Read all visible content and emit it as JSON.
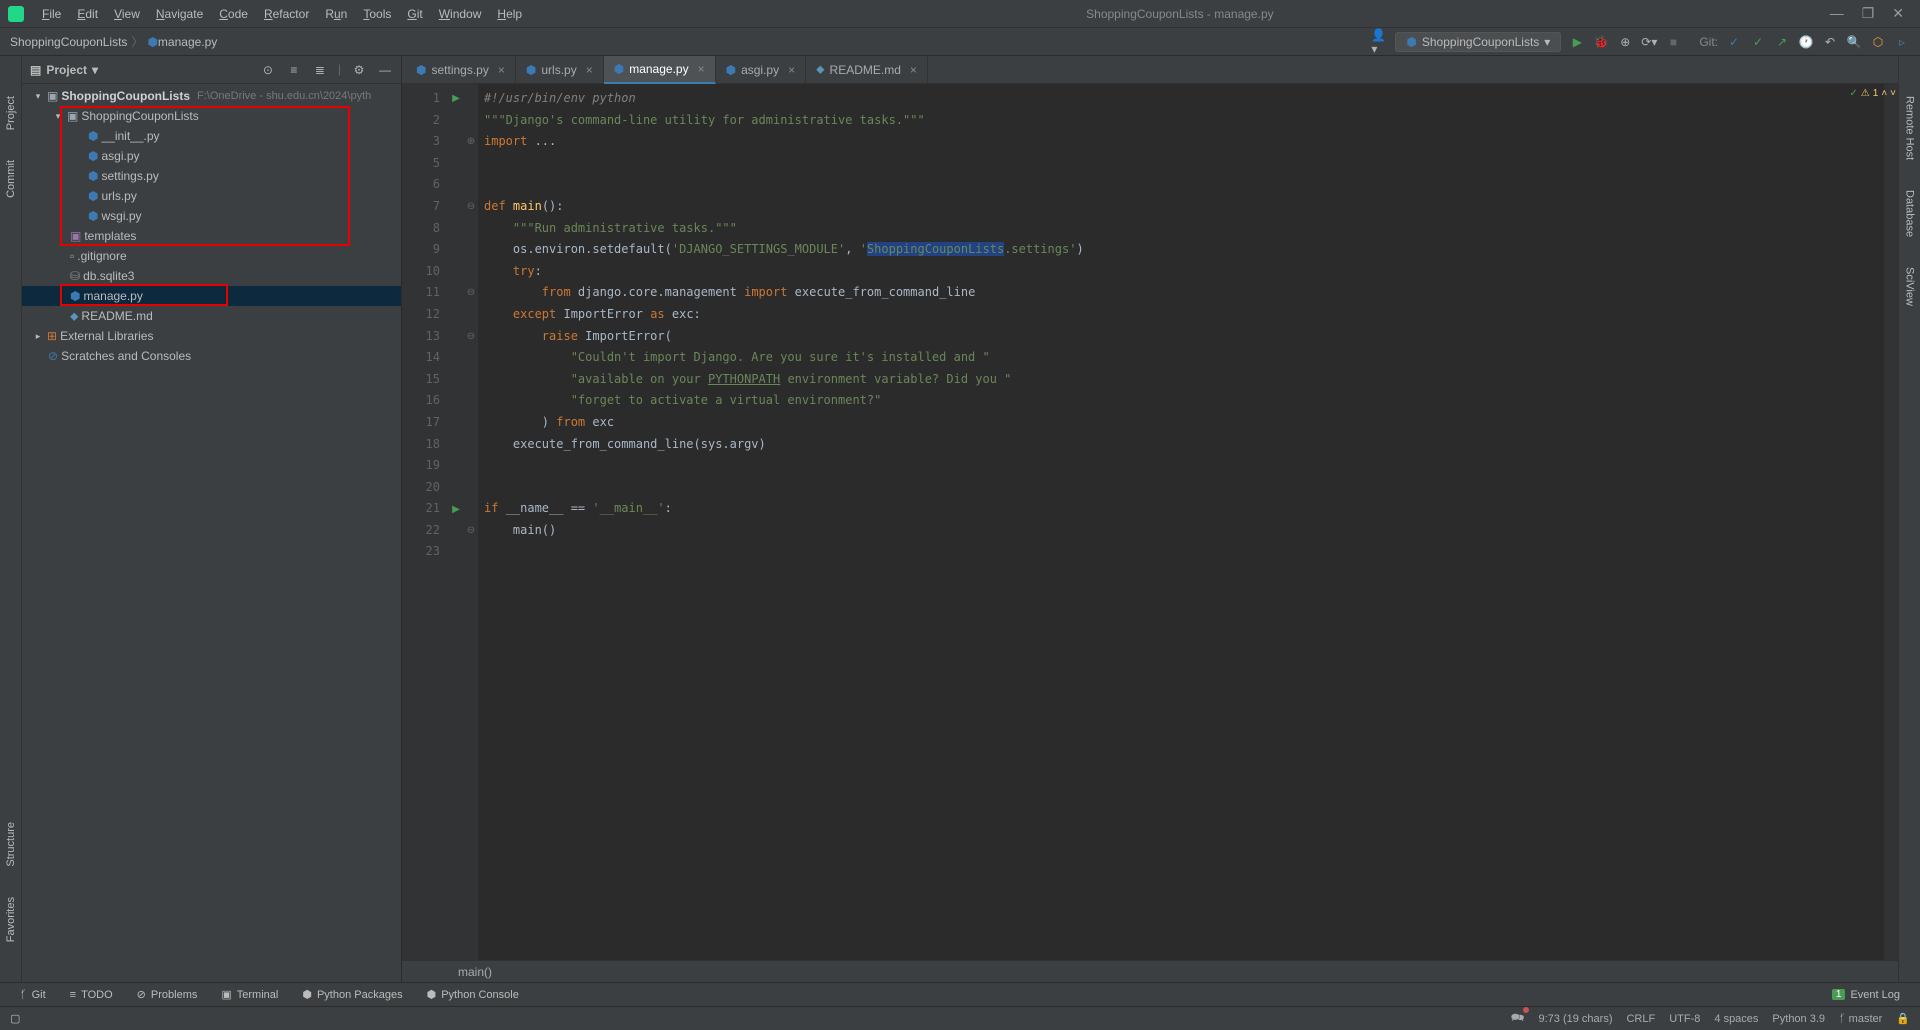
{
  "window": {
    "title": "ShoppingCouponLists - manage.py",
    "menus": [
      "File",
      "Edit",
      "View",
      "Navigate",
      "Code",
      "Refactor",
      "Run",
      "Tools",
      "Git",
      "Window",
      "Help"
    ]
  },
  "breadcrumb": {
    "root": "ShoppingCouponLists",
    "file": "manage.py"
  },
  "run_config": "ShoppingCouponLists",
  "git_label": "Git:",
  "project_panel": {
    "title": "Project",
    "tree": {
      "root": "ShoppingCouponLists",
      "root_path": "F:\\OneDrive - shu.edu.cn\\2024\\pyth",
      "pkg": "ShoppingCouponLists",
      "files": [
        "__init__.py",
        "asgi.py",
        "settings.py",
        "urls.py",
        "wsgi.py"
      ],
      "templates": "templates",
      "gitignore": ".gitignore",
      "db": "db.sqlite3",
      "manage": "manage.py",
      "readme": "README.md",
      "ext": "External Libraries",
      "scratch": "Scratches and Consoles"
    }
  },
  "tabs": [
    {
      "label": "settings.py"
    },
    {
      "label": "urls.py"
    },
    {
      "label": "manage.py",
      "active": true
    },
    {
      "label": "asgi.py"
    },
    {
      "label": "README.md"
    }
  ],
  "code": {
    "l1": "#!/usr/bin/env python",
    "l2": "\"\"\"Django's command-line utility for administrative tasks.\"\"\"",
    "l3a": "import",
    "l3b": " ...",
    "l7a": "def ",
    "l7b": "main",
    "l7c": "():",
    "l8": "    \"\"\"Run administrative tasks.\"\"\"",
    "l9a": "    os.environ.setdefault(",
    "l9b": "'DJANGO_SETTINGS_MODULE'",
    "l9c": ", ",
    "l9d": "'",
    "l9e": "ShoppingCouponLists",
    "l9f": ".settings'",
    "l9g": ")",
    "l10a": "    ",
    "l10b": "try",
    "l10c": ":",
    "l11a": "        ",
    "l11b": "from ",
    "l11c": "django.core.management ",
    "l11d": "import ",
    "l11e": "execute_from_command_line",
    "l12a": "    ",
    "l12b": "except ",
    "l12c": "ImportError ",
    "l12d": "as ",
    "l12e": "exc:",
    "l13a": "        ",
    "l13b": "raise ",
    "l13c": "ImportError(",
    "l14": "            \"Couldn't import Django. Are you sure it's installed and \"",
    "l15a": "            \"available on your ",
    "l15b": "PYTHONPATH",
    "l15c": " environment variable? Did you \"",
    "l16": "            \"forget to activate a virtual environment?\"",
    "l17a": "        ) ",
    "l17b": "from ",
    "l17c": "exc",
    "l18": "    execute_from_command_line(sys.argv)",
    "l21a": "if ",
    "l21b": "__name__ == ",
    "l21c": "'__main__'",
    "l21d": ":",
    "l22": "    main()"
  },
  "crumb_fn": "main()",
  "warn_count": "1",
  "bottom_tools": {
    "git": "Git",
    "todo": "TODO",
    "problems": "Problems",
    "terminal": "Terminal",
    "pypkg": "Python Packages",
    "pyconsole": "Python Console",
    "eventlog": "Event Log",
    "evcount": "1"
  },
  "status": {
    "pos": "9:73 (19 chars)",
    "sep": "CRLF",
    "enc": "UTF-8",
    "indent": "4 spaces",
    "py": "Python 3.9",
    "branch": "master"
  },
  "left_gutter": {
    "project": "Project",
    "commit": "Commit",
    "structure": "Structure",
    "favorites": "Favorites"
  },
  "right_gutter": {
    "remote": "Remote Host",
    "db": "Database",
    "sci": "SciView"
  }
}
